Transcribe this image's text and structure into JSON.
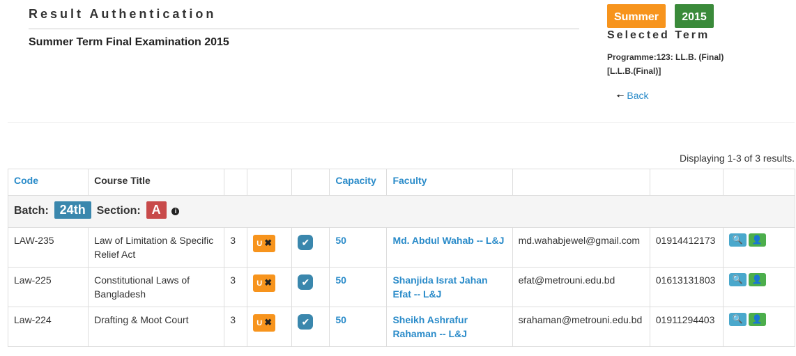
{
  "header": {
    "title": "Result Authentication",
    "subtitle": "Summer Term Final Examination 2015"
  },
  "term": {
    "season": "Summer",
    "year": "2015",
    "label": "Selected Term",
    "programme_line1": "Programme:123: LL.B. (Final)",
    "programme_line2": "[L.L.B.(Final)]",
    "back_label": "Back"
  },
  "summary": "Displaying 1-3 of 3 results.",
  "table": {
    "columns": [
      "Code",
      "Course Title",
      "",
      "",
      "",
      "Capacity",
      "Faculty",
      "",
      "",
      ""
    ],
    "batch_label": "Batch:",
    "batch_value": "24th",
    "section_label": "Section:",
    "section_value": "A",
    "unassign_label": "U",
    "rows": [
      {
        "code": "LAW-235",
        "title": "Law of Limitation & Specific Relief Act",
        "credit": "3",
        "capacity": "50",
        "faculty": "Md. Abdul Wahab -- L&J",
        "email": "md.wahabjewel@gmail.com",
        "phone": "01914412173"
      },
      {
        "code": "Law-225",
        "title": "Constitutional Laws of Bangladesh",
        "credit": "3",
        "capacity": "50",
        "faculty": "Shanjida Israt Jahan Efat -- L&J",
        "email": "efat@metrouni.edu.bd",
        "phone": "01613131803"
      },
      {
        "code": "Law-224",
        "title": "Drafting & Moot Court",
        "credit": "3",
        "capacity": "50",
        "faculty": "Sheikh Ashrafur Rahaman -- L&J",
        "email": "srahaman@metrouni.edu.bd",
        "phone": "01911294403"
      }
    ]
  },
  "colors": {
    "summer": "#f7941d",
    "year": "#3a8a3a",
    "link": "#2a8bc9",
    "batch": "#3a87ad",
    "section": "#c84a4a"
  }
}
